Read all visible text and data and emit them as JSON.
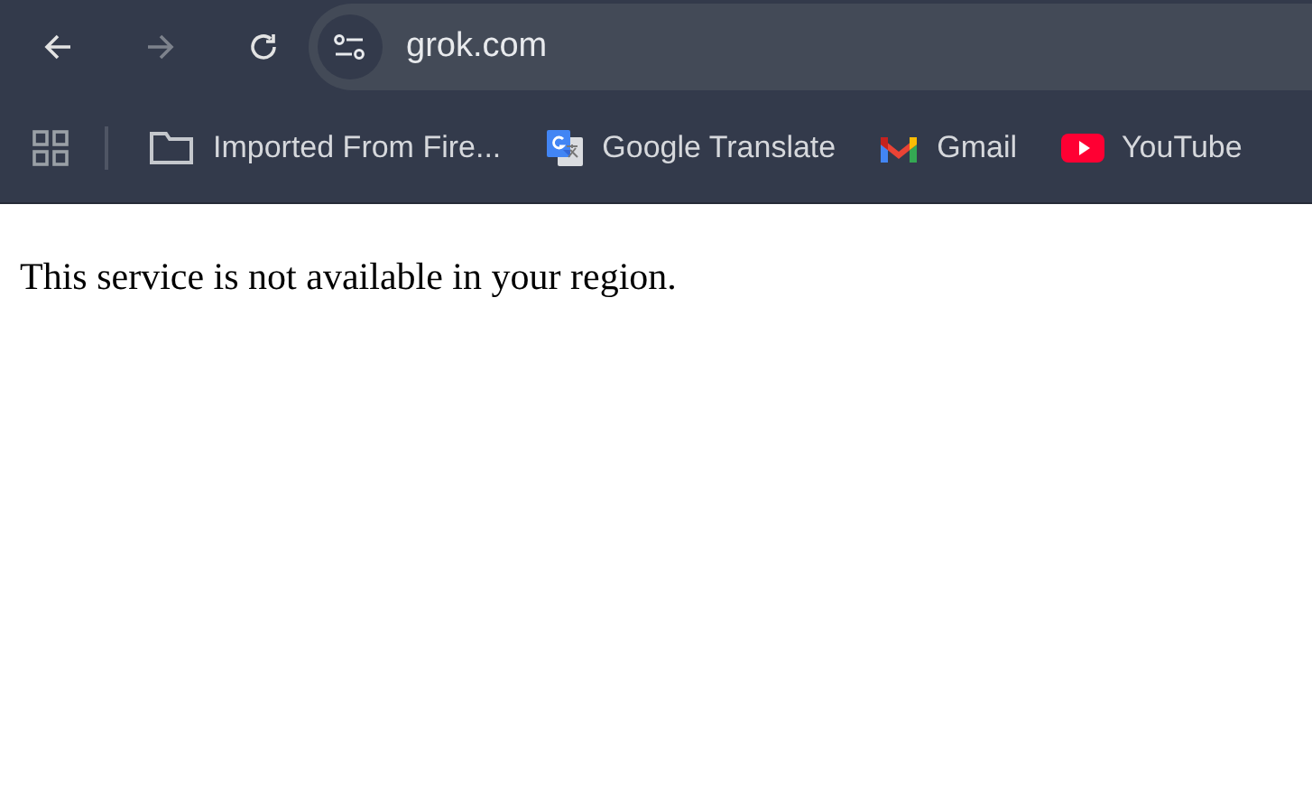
{
  "toolbar": {
    "back": {
      "disabled": false
    },
    "forward": {
      "disabled": true
    },
    "address": "grok.com"
  },
  "bookmarks": [
    {
      "kind": "folder",
      "label": "Imported From Fire..."
    },
    {
      "kind": "translate",
      "label": "Google Translate"
    },
    {
      "kind": "gmail",
      "label": "Gmail"
    },
    {
      "kind": "youtube",
      "label": "YouTube"
    }
  ],
  "page": {
    "message": "This service is not available in your region."
  }
}
